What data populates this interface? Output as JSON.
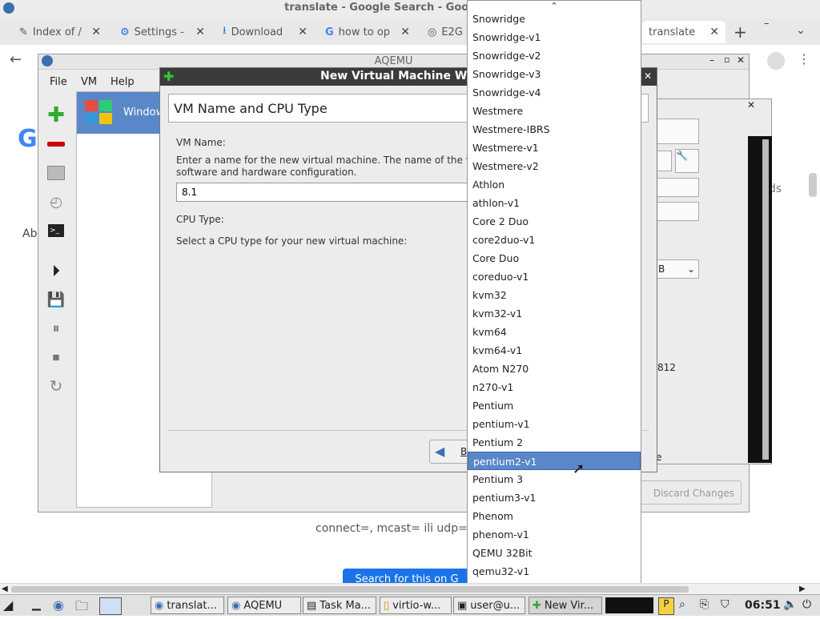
{
  "browser": {
    "window_title": "translate - Google Search - Google Chrome",
    "tabs": [
      {
        "label": "Index of /"
      },
      {
        "label": "Settings -"
      },
      {
        "label": "Download"
      },
      {
        "label": "how to op"
      },
      {
        "label": "E2G"
      },
      {
        "label": "translate"
      }
    ],
    "new_tab": "+",
    "page_texts": {
      "about": "Abo",
      "right_snippet": "ds",
      "snippet_text": "connect=, mcast= ili udp=",
      "search_button": "Search for this on G"
    }
  },
  "aqemu": {
    "title": "AQEMU",
    "menu": [
      "File",
      "VM",
      "Help"
    ],
    "vm_item": "Windows"
  },
  "wizard": {
    "title": "New Virtual Machine Wizard",
    "header": "VM Name and CPU Type",
    "vm_name_label": "VM Name:",
    "vm_name_desc_1": "Enter a name for the new virtual machine. The name of the vir",
    "vm_name_desc_2": "software and hardware configuration.",
    "vm_name_value": "8.1",
    "cpu_type_label": "CPU Type:",
    "cpu_type_desc": "Select a CPU type for your new virtual machine:",
    "back_label": "B"
  },
  "settings_behind": {
    "value_812": "812",
    "letter_b": "B",
    "letter_e": "e",
    "discard_label": "Discard Changes"
  },
  "cpu_list": {
    "items": [
      "Snowridge",
      "Snowridge-v1",
      "Snowridge-v2",
      "Snowridge-v3",
      "Snowridge-v4",
      "Westmere",
      "Westmere-IBRS",
      "Westmere-v1",
      "Westmere-v2",
      "Athlon",
      "athlon-v1",
      "Core 2 Duo",
      "core2duo-v1",
      "Core Duo",
      "coreduo-v1",
      "kvm32",
      "kvm32-v1",
      "kvm64",
      "kvm64-v1",
      "Atom N270",
      "n270-v1",
      "Pentium",
      "pentium-v1",
      "Pentium 2",
      "pentium2-v1",
      "Pentium 3",
      "pentium3-v1",
      "Phenom",
      "phenom-v1",
      "QEMU 32Bit",
      "qemu32-v1"
    ],
    "selected": "pentium2-v1"
  },
  "taskbar": {
    "tasks": [
      "translat...",
      "AQEMU",
      "Task Ma...",
      "virtio-w...",
      "user@u...",
      "New Vir..."
    ],
    "clock": "06:51"
  },
  "colors": {
    "selection": "#5a87c8",
    "wizard_title_bg": "#3b3b3b",
    "accent_blue": "#1a73e8"
  }
}
